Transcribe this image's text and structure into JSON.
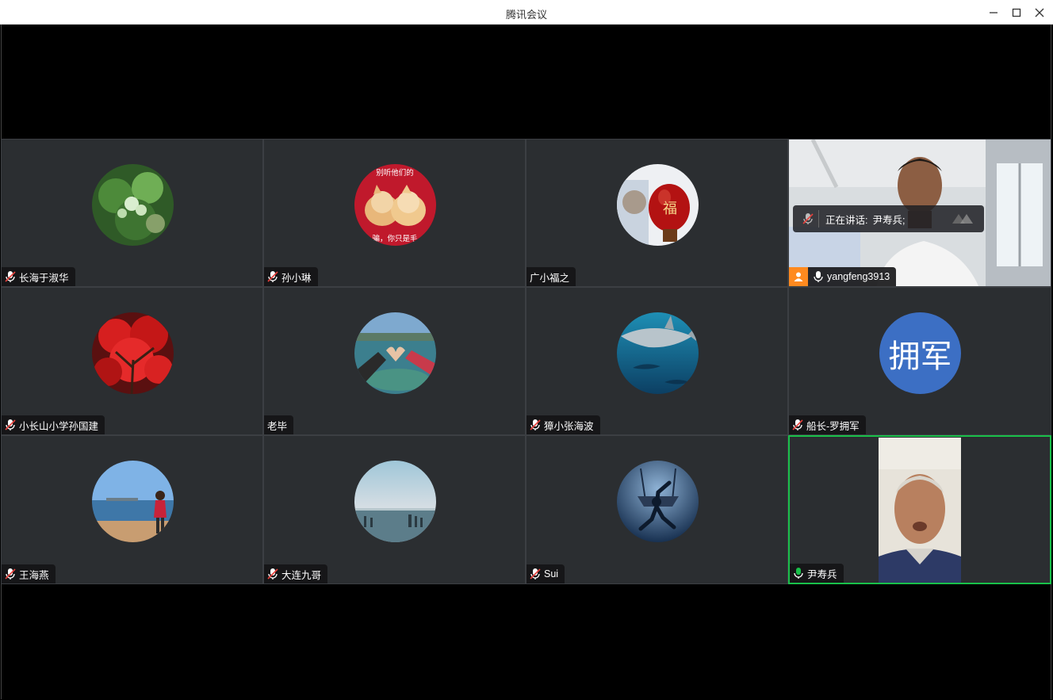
{
  "window": {
    "title": "腾讯会议"
  },
  "speaking_banner": {
    "label": "正在讲话:",
    "speaker": "尹寿兵;"
  },
  "participants": [
    {
      "name": "长海于淑华",
      "mic": "muted"
    },
    {
      "name": "孙小琳",
      "mic": "muted",
      "avatar_caption_top": "别听他们的",
      "avatar_caption_bottom": "骗，你只是毛"
    },
    {
      "name": "广小福之",
      "mic": "none",
      "avatar_caption": "福"
    },
    {
      "name": "yangfeng3913",
      "mic": "on"
    },
    {
      "name": "小长山小学孙国建",
      "mic": "muted"
    },
    {
      "name": "老毕",
      "mic": "none"
    },
    {
      "name": "獐小张海波",
      "mic": "muted"
    },
    {
      "name": "船长-罗拥军",
      "mic": "muted",
      "avatar_text": "拥军"
    },
    {
      "name": "王海燕",
      "mic": "muted"
    },
    {
      "name": "大连九哥",
      "mic": "muted"
    },
    {
      "name": "Sui",
      "mic": "muted"
    },
    {
      "name": "尹寿兵",
      "mic": "speaking"
    }
  ],
  "colors": {
    "tile_bg": "#2b2e31",
    "active_border": "#19c04a",
    "text_avatar_bg": "#3c6fc4",
    "host_badge": "#ff8a1f",
    "muted_mic": "#e8413c"
  }
}
